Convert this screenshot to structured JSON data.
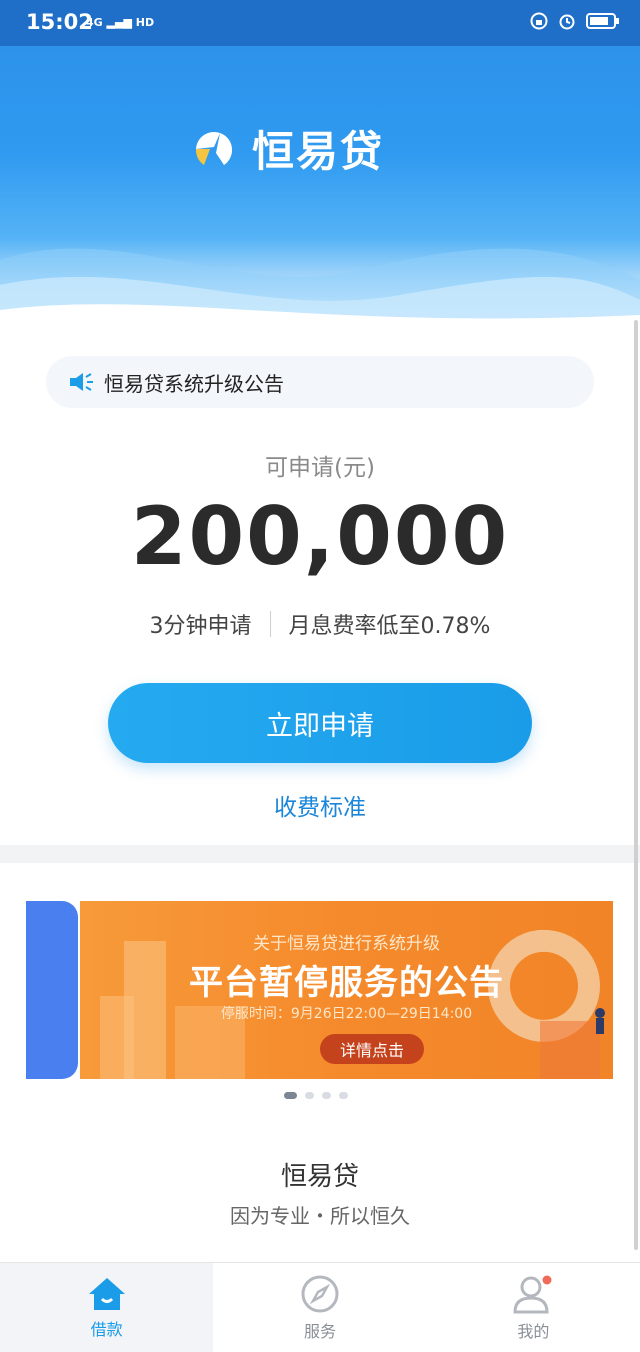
{
  "status_bar": {
    "time": "15:02",
    "network": "4G",
    "hd": "HD"
  },
  "header": {
    "app_name": "恒易贷"
  },
  "notice": {
    "text": "恒易贷系统升级公告"
  },
  "loan": {
    "available_label": "可申请(元)",
    "amount": "200,000",
    "info_left": "3分钟申请",
    "info_right": "月息费率低至0.78%",
    "apply_label": "立即申请",
    "fee_link": "收费标准"
  },
  "banner": {
    "line1": "关于恒易贷进行系统升级",
    "line2": "平台暂停服务的公告",
    "line3": "停服时间：9月26日22:00—29日14:00",
    "button": "详情点击",
    "page_count": 4,
    "active_page": 1
  },
  "brand": {
    "name": "恒易贷",
    "slogan": "因为专业・所以恒久"
  },
  "tabbar": {
    "items": [
      {
        "label": "借款",
        "icon": "home-icon",
        "active": true
      },
      {
        "label": "服务",
        "icon": "compass-icon",
        "active": false
      },
      {
        "label": "我的",
        "icon": "user-icon",
        "active": false
      }
    ]
  },
  "colors": {
    "primary": "#1f9ae8",
    "accent_link": "#1b86d8",
    "banner_orange": "#f58a2c"
  }
}
